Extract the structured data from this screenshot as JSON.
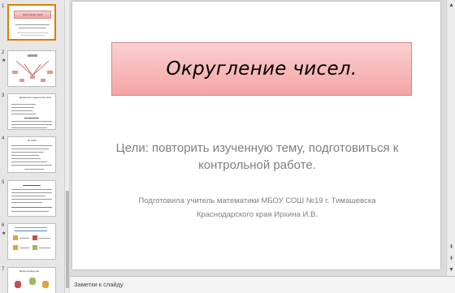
{
  "slide": {
    "title": "Округление  чисел.",
    "subtitle": "Цели: повторить изученную тему, подготовиться к контрольной работе.",
    "author_line1": "Подготовила учитель математики МБОУ СОШ №19 г. Тимашевска",
    "author_line2": "Краснодарского края    Ирхина И.В."
  },
  "thumbnails": [
    {
      "number": "1",
      "star": "",
      "title": "Округление чисел"
    },
    {
      "number": "2",
      "star": "★",
      "title": ""
    },
    {
      "number": "3",
      "star": "",
      "title": "Домашнее задание № 1410"
    },
    {
      "number": "4",
      "star": "",
      "title": "№ 1362"
    },
    {
      "number": "5",
      "star": "",
      "title": ""
    },
    {
      "number": "6",
      "star": "★",
      "title": ""
    },
    {
      "number": "7",
      "star": "",
      "title": "Физкультминутка"
    }
  ],
  "notes": {
    "placeholder": "Заметки к слайду"
  },
  "colors": {
    "selection": "#e07b00",
    "title_fill_top": "#fbd0d0",
    "title_fill_bottom": "#f4a5a5"
  }
}
